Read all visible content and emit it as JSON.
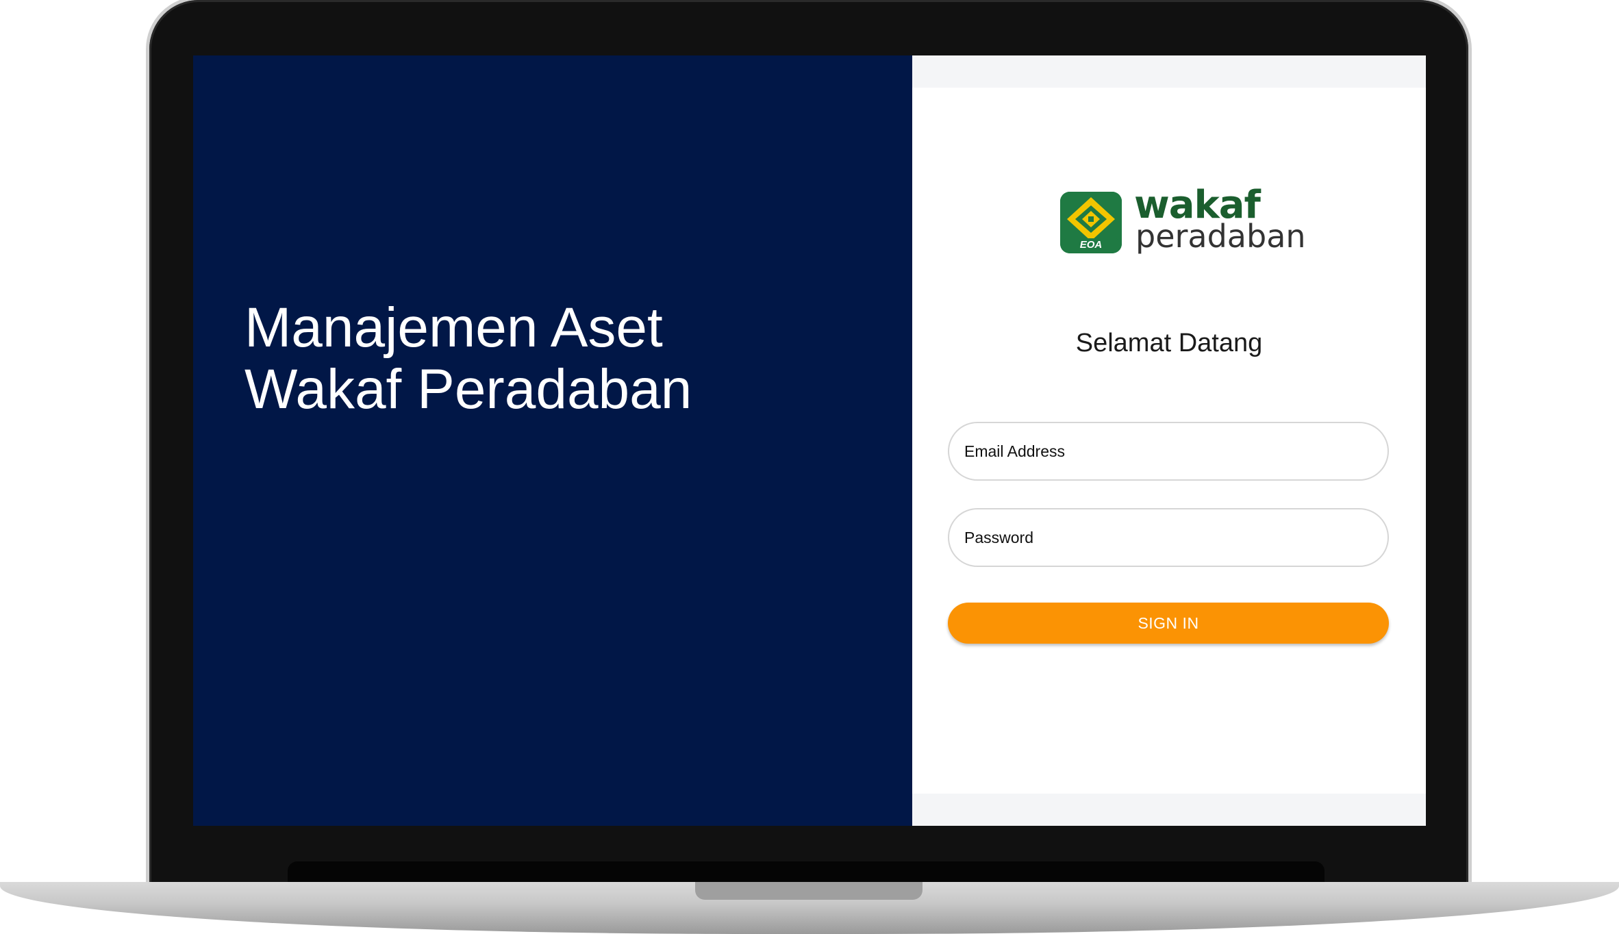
{
  "hero": {
    "line1": "Manajemen Aset",
    "line2": "Wakaf Peradaban"
  },
  "logo": {
    "word1": "wakaf",
    "word2": "peradaban",
    "badge": "EOA",
    "icon": "wakaf-peradaban-logo-icon"
  },
  "login": {
    "welcome": "Selamat Datang",
    "email_placeholder": "Email Address",
    "password_placeholder": "Password",
    "signin_label": "SIGN IN"
  },
  "colors": {
    "left_panel": "#011747",
    "signin_button": "#fb9304",
    "logo_green": "#1f7a43",
    "logo_yellow": "#f2c500"
  }
}
